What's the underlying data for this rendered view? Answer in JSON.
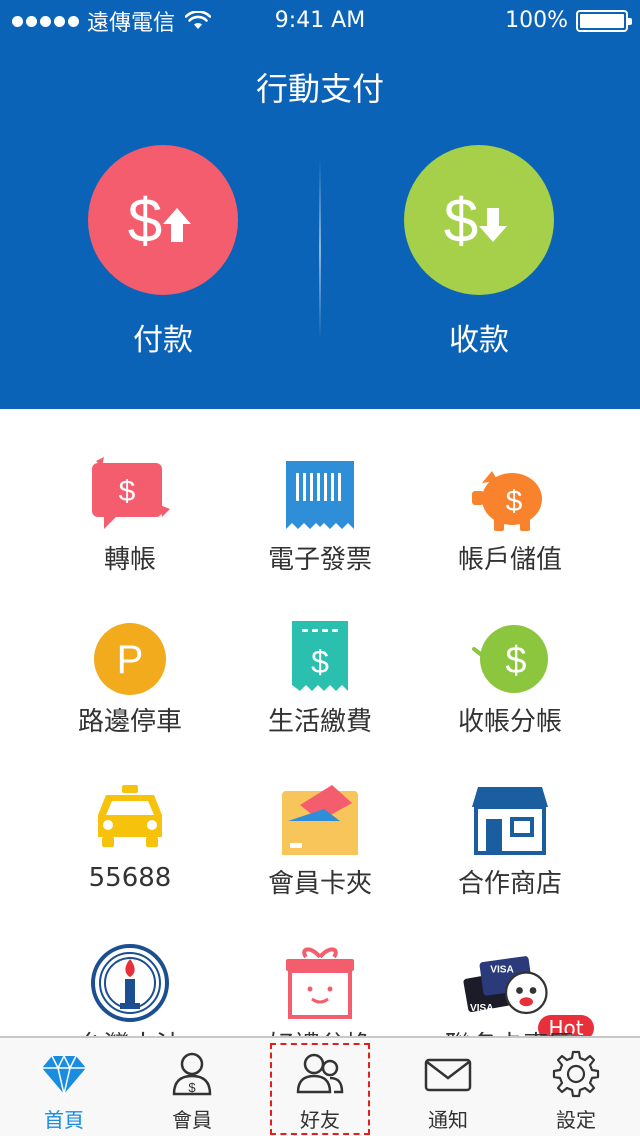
{
  "status": {
    "carrier": "遠傳電信",
    "time": "9:41 AM",
    "battery_text": "100%",
    "battery_level": 1.0,
    "signal_dots": 5
  },
  "header": {
    "title": "行動支付",
    "pay_label": "付款",
    "receive_label": "收款",
    "pay_color": "#f45d6e",
    "receive_color": "#a6cf4a",
    "background": "#0b63b8"
  },
  "grid": {
    "items": [
      {
        "label": "轉帳",
        "icon": "transfer-icon"
      },
      {
        "label": "電子發票",
        "icon": "e-invoice-icon"
      },
      {
        "label": "帳戶儲值",
        "icon": "piggy-bank-icon"
      },
      {
        "label": "路邊停車",
        "icon": "parking-icon"
      },
      {
        "label": "生活繳費",
        "icon": "bill-payment-icon"
      },
      {
        "label": "收帳分帳",
        "icon": "split-bill-icon"
      },
      {
        "label": "55688",
        "icon": "taxi-icon"
      },
      {
        "label": "會員卡夾",
        "icon": "card-wallet-icon"
      },
      {
        "label": "合作商店",
        "icon": "store-icon"
      },
      {
        "label": "台灣大油",
        "icon": "torch-logo-icon"
      },
      {
        "label": "好禮兌換",
        "icon": "gift-icon"
      },
      {
        "label": "聯名卡專區",
        "icon": "visa-cards-icon"
      }
    ],
    "hot_badge": "Hot"
  },
  "tabbar": {
    "tabs": [
      {
        "label": "首頁",
        "icon": "diamond-icon",
        "active": true
      },
      {
        "label": "會員",
        "icon": "member-icon",
        "active": false
      },
      {
        "label": "好友",
        "icon": "friends-icon",
        "active": false
      },
      {
        "label": "通知",
        "icon": "mail-icon",
        "active": false
      },
      {
        "label": "設定",
        "icon": "gear-icon",
        "active": false
      }
    ],
    "active_color": "#1a8de0"
  }
}
